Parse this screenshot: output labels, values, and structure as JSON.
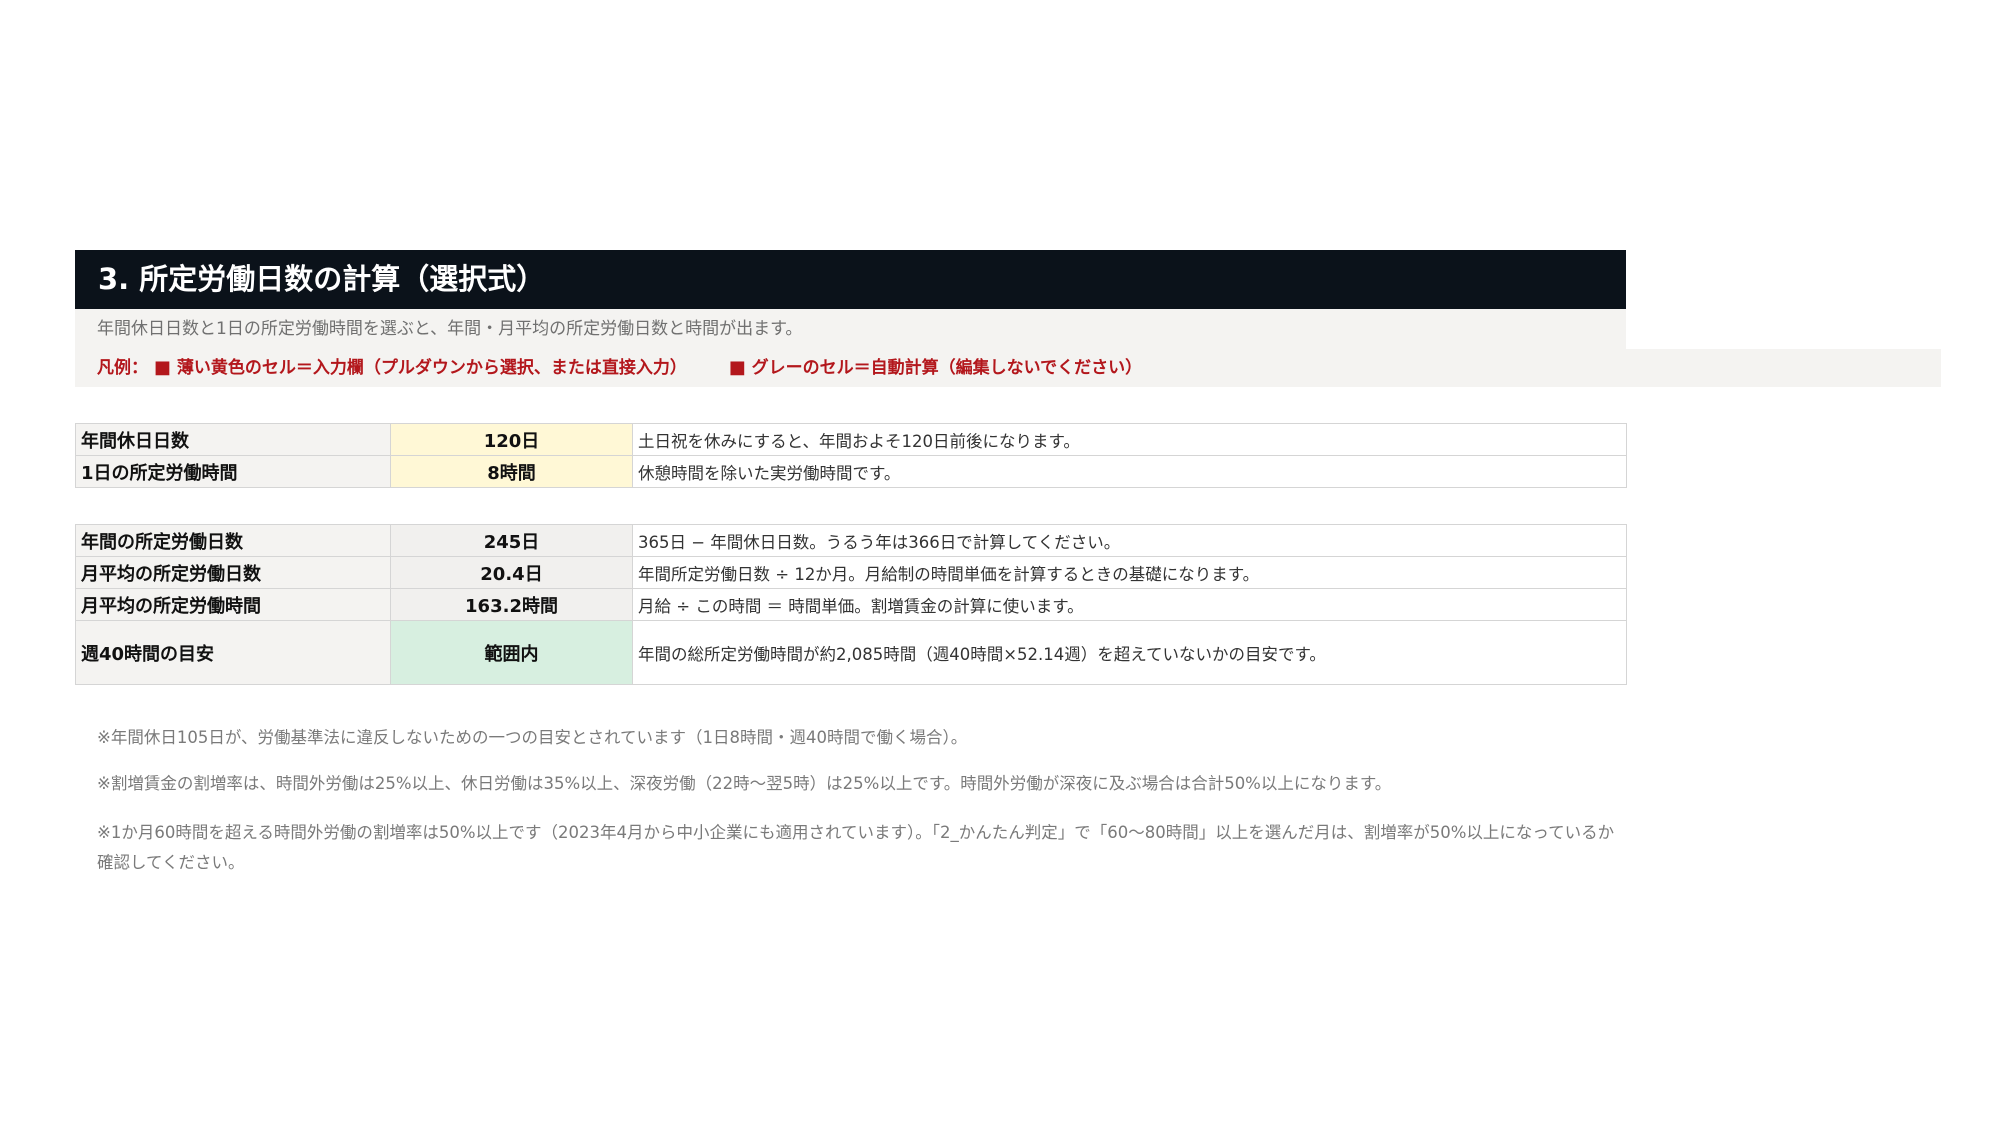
{
  "section": {
    "title": "3. 所定労働日数の計算（選択式）",
    "description": "年間休日日数と1日の所定労働時間を選ぶと、年間・月平均の所定労働日数と時間が出ます。",
    "legend": {
      "prefix": "凡例：",
      "square": "■",
      "input_text": "薄い黄色のセル＝入力欄（プルダウンから選択、または直接入力）",
      "auto_text": "グレーのセル＝自動計算（編集しないでください）"
    }
  },
  "inputs": [
    {
      "label": "年間休日日数",
      "value": "120日",
      "note": "土日祝を休みにすると、年間およそ120日前後になります。"
    },
    {
      "label": "1日の所定労働時間",
      "value": "8時間",
      "note": "休憩時間を除いた実労働時間です。"
    }
  ],
  "results": [
    {
      "label": "年間の所定労働日数",
      "value": "245日",
      "note": "365日 − 年間休日日数。うるう年は366日で計算してください。"
    },
    {
      "label": "月平均の所定労働日数",
      "value": "20.4日",
      "note": "年間所定労働日数 ÷ 12か月。月給制の時間単価を計算するときの基礎になります。"
    },
    {
      "label": "月平均の所定労働時間",
      "value": "163.2時間",
      "note": "月給 ÷ この時間 ＝ 時間単価。割増賃金の計算に使います。"
    },
    {
      "label": "週40時間の目安",
      "value": "範囲内",
      "note": "年間の総所定労働時間が約2,085時間（週40時間×52.14週）を超えていないかの目安です。"
    }
  ],
  "footnotes": [
    "※年間休日105日が、労働基準法に違反しないための一つの目安とされています（1日8時間・週40時間で働く場合）。",
    "※割増賃金の割増率は、時間外労働は25%以上、休日労働は35%以上、深夜労働（22時～翌5時）は25%以上です。時間外労働が深夜に及ぶ場合は合計50%以上になります。",
    "※1か月60時間を超える時間外労働の割増率は50%以上です（2023年4月から中小企業にも適用されています）。「2_かんたん判定」で「60～80時間」以上を選んだ月は、割増率が50%以上になっているか確認してください。"
  ],
  "colors": {
    "title_bg": "#0b121a",
    "legend_red": "#b3171c",
    "input_cell": "#fff8d6",
    "auto_cell": "#f1f0ee",
    "status_ok_cell": "#d7efe0"
  }
}
